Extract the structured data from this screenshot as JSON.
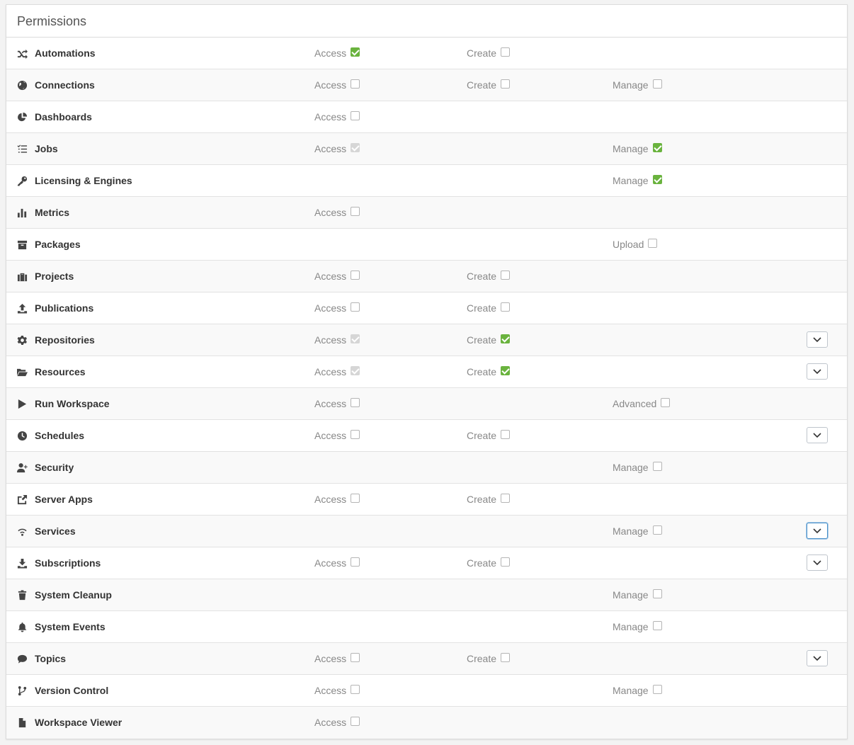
{
  "panel": {
    "title": "Permissions"
  },
  "rows": [
    {
      "name": "Automations",
      "icon": "shuffle-icon",
      "access": {
        "label": "Access",
        "checked": true
      },
      "create": {
        "label": "Create",
        "checked": false
      }
    },
    {
      "name": "Connections",
      "icon": "globe-icon",
      "access": {
        "label": "Access",
        "checked": false
      },
      "create": {
        "label": "Create",
        "checked": false
      },
      "manage": {
        "label": "Manage",
        "checked": false
      }
    },
    {
      "name": "Dashboards",
      "icon": "pie-chart-icon",
      "access": {
        "label": "Access",
        "checked": false
      }
    },
    {
      "name": "Jobs",
      "icon": "list-icon",
      "access": {
        "label": "Access",
        "checked": true,
        "disabled": true
      },
      "manage": {
        "label": "Manage",
        "checked": true
      }
    },
    {
      "name": "Licensing & Engines",
      "icon": "key-icon",
      "manage": {
        "label": "Manage",
        "checked": true
      }
    },
    {
      "name": "Metrics",
      "icon": "bar-chart-icon",
      "access": {
        "label": "Access",
        "checked": false
      }
    },
    {
      "name": "Packages",
      "icon": "archive-icon",
      "manage": {
        "label": "Upload",
        "checked": false
      }
    },
    {
      "name": "Projects",
      "icon": "briefcase-icon",
      "access": {
        "label": "Access",
        "checked": false
      },
      "create": {
        "label": "Create",
        "checked": false
      }
    },
    {
      "name": "Publications",
      "icon": "upload-icon",
      "access": {
        "label": "Access",
        "checked": false
      },
      "create": {
        "label": "Create",
        "checked": false
      }
    },
    {
      "name": "Repositories",
      "icon": "gear-icon",
      "access": {
        "label": "Access",
        "checked": true,
        "disabled": true
      },
      "create": {
        "label": "Create",
        "checked": true
      },
      "expand": true
    },
    {
      "name": "Resources",
      "icon": "folder-open-icon",
      "access": {
        "label": "Access",
        "checked": true,
        "disabled": true
      },
      "create": {
        "label": "Create",
        "checked": true
      },
      "expand": true
    },
    {
      "name": "Run Workspace",
      "icon": "play-icon",
      "access": {
        "label": "Access",
        "checked": false
      },
      "manage": {
        "label": "Advanced",
        "checked": false
      }
    },
    {
      "name": "Schedules",
      "icon": "clock-icon",
      "access": {
        "label": "Access",
        "checked": false
      },
      "create": {
        "label": "Create",
        "checked": false
      },
      "expand": true
    },
    {
      "name": "Security",
      "icon": "user-plus-icon",
      "manage": {
        "label": "Manage",
        "checked": false
      }
    },
    {
      "name": "Server Apps",
      "icon": "share-icon",
      "access": {
        "label": "Access",
        "checked": false
      },
      "create": {
        "label": "Create",
        "checked": false
      }
    },
    {
      "name": "Services",
      "icon": "wifi-icon",
      "manage": {
        "label": "Manage",
        "checked": false
      },
      "expand": true,
      "expand_focused": true
    },
    {
      "name": "Subscriptions",
      "icon": "download-icon",
      "access": {
        "label": "Access",
        "checked": false
      },
      "create": {
        "label": "Create",
        "checked": false
      },
      "expand": true
    },
    {
      "name": "System Cleanup",
      "icon": "trash-icon",
      "manage": {
        "label": "Manage",
        "checked": false
      }
    },
    {
      "name": "System Events",
      "icon": "bell-icon",
      "manage": {
        "label": "Manage",
        "checked": false
      }
    },
    {
      "name": "Topics",
      "icon": "comment-icon",
      "access": {
        "label": "Access",
        "checked": false
      },
      "create": {
        "label": "Create",
        "checked": false
      },
      "expand": true
    },
    {
      "name": "Version Control",
      "icon": "code-branch-icon",
      "access": {
        "label": "Access",
        "checked": false
      },
      "manage": {
        "label": "Manage",
        "checked": false
      }
    },
    {
      "name": "Workspace Viewer",
      "icon": "file-icon",
      "access": {
        "label": "Access",
        "checked": false
      }
    }
  ],
  "colors": {
    "checked": "#6ab33e",
    "checked_disabled": "#d6d6d6",
    "focus": "#4a90c8"
  }
}
